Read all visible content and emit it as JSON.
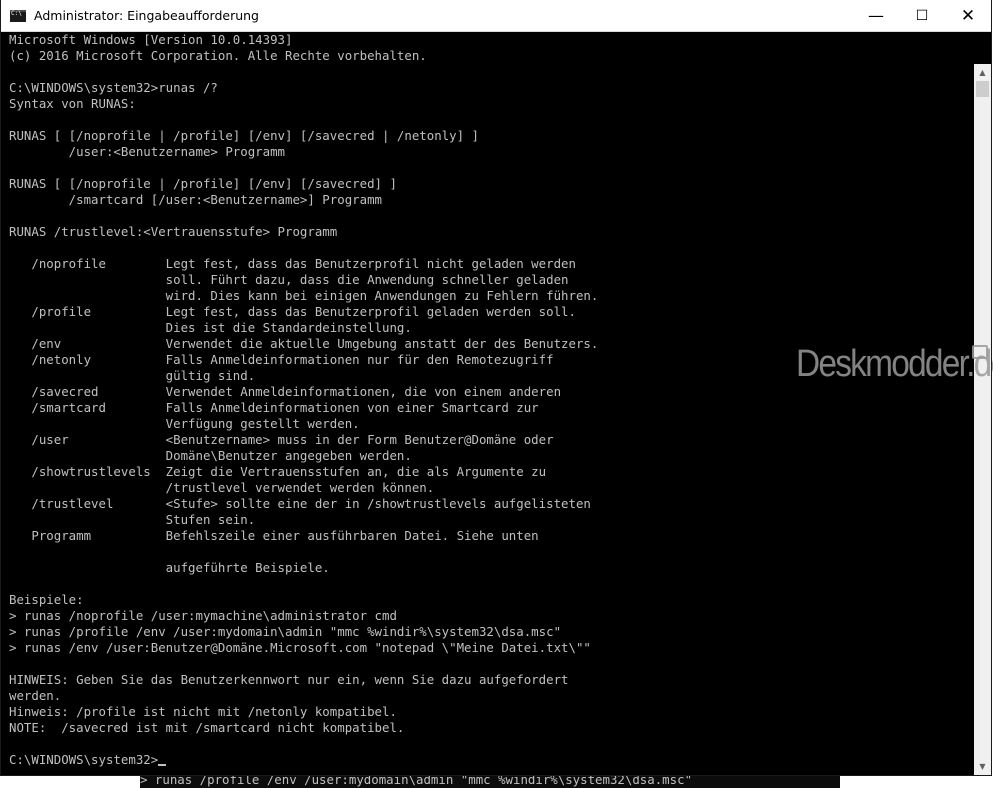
{
  "window": {
    "title": "Administrator: Eingabeaufforderung",
    "app_icon": "cmd-icon",
    "buttons": {
      "minimize": "—",
      "maximize": "☐",
      "close": "✕"
    }
  },
  "console": {
    "lines": [
      "Microsoft Windows [Version 10.0.14393]",
      "(c) 2016 Microsoft Corporation. Alle Rechte vorbehalten.",
      "",
      "C:\\WINDOWS\\system32>runas /?",
      "Syntax von RUNAS:",
      "",
      "RUNAS [ [/noprofile | /profile] [/env] [/savecred | /netonly] ]",
      "        /user:<Benutzername> Programm",
      "",
      "RUNAS [ [/noprofile | /profile] [/env] [/savecred] ]",
      "        /smartcard [/user:<Benutzername>] Programm",
      "",
      "RUNAS /trustlevel:<Vertrauensstufe> Programm",
      "",
      "   /noprofile        Legt fest, dass das Benutzerprofil nicht geladen werden",
      "                     soll. Führt dazu, dass die Anwendung schneller geladen",
      "                     wird. Dies kann bei einigen Anwendungen zu Fehlern führen.",
      "   /profile          Legt fest, dass das Benutzerprofil geladen werden soll.",
      "                     Dies ist die Standardeinstellung.",
      "   /env              Verwendet die aktuelle Umgebung anstatt der des Benutzers.",
      "   /netonly          Falls Anmeldeinformationen nur für den Remotezugriff",
      "                     gültig sind.",
      "   /savecred         Verwendet Anmeldeinformationen, die von einem anderen",
      "   /smartcard        Falls Anmeldeinformationen von einer Smartcard zur",
      "                     Verfügung gestellt werden.",
      "   /user             <Benutzername> muss in der Form Benutzer@Domäne oder",
      "                     Domäne\\Benutzer angegeben werden.",
      "   /showtrustlevels  Zeigt die Vertrauensstufen an, die als Argumente zu",
      "                     /trustlevel verwendet werden können.",
      "   /trustlevel       <Stufe> sollte eine der in /showtrustlevels aufgelisteten",
      "                     Stufen sein.",
      "   Programm          Befehlszeile einer ausführbaren Datei. Siehe unten",
      "",
      "                     aufgeführte Beispiele.",
      "",
      "Beispiele:",
      "> runas /noprofile /user:mymachine\\administrator cmd",
      "> runas /profile /env /user:mydomain\\admin \"mmc %windir%\\system32\\dsa.msc\"",
      "> runas /env /user:Benutzer@Domäne.Microsoft.com \"notepad \\\"Meine Datei.txt\\\"\"",
      "",
      "HINWEIS: Geben Sie das Benutzerkennwort nur ein, wenn Sie dazu aufgefordert",
      "werden.",
      "Hinweis: /profile ist nicht mit /netonly kompatibel.",
      "NOTE:  /savecred ist mit /smartcard nicht kompatibel.",
      ""
    ],
    "prompt": "C:\\WINDOWS\\system32>"
  },
  "watermark": {
    "text": "Deskmodder.de",
    "icon": "external-link-icon"
  },
  "background_window": {
    "text": "> runas /profile /env /user:mydomain\\admin \"mmc %windir%\\system32\\dsa.msc\""
  },
  "scrollbar": {
    "up_arrow": "▲",
    "down_arrow": "▼"
  }
}
